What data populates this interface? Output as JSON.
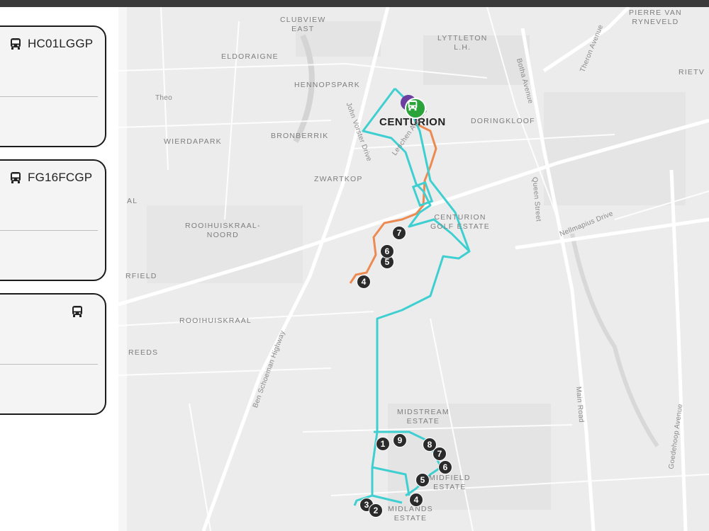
{
  "vehicles": [
    {
      "plate": "HC01LGGP",
      "icon": "bus-icon"
    },
    {
      "plate": "FG16FCGP",
      "icon": "bus-icon"
    },
    {
      "plate": "",
      "icon": "bus-icon"
    }
  ],
  "map": {
    "labels": {
      "clubview": "CLUBVIEW\nEAST",
      "lyttleton": "LYTTLETON\nL.H.",
      "pierre": "PIERRE VAN\nRYNEVELD",
      "eldoraigne": "ELDORAIGNE",
      "hennopspark": "HENNOPSPARK",
      "rietv": "RIETV",
      "theo": "Theo",
      "doringkloof": "DORINGKLOOF",
      "bronberrik": "BRONBERRIK",
      "wierdapark": "WIERDAPARK",
      "zwartkop": "ZWARTKOP",
      "centurion_golf": "CENTURION\nGOLF ESTATE",
      "rooihuiskraal_noord": "ROOIHUISKRAAL-\nNOORD",
      "al": "AL",
      "rfield": "RFIELD",
      "rooihuiskraal": "ROOIHUISKRAAL",
      "reeds": "REEDS",
      "midstream": "MIDSTREAM\nESTATE",
      "midfield": "MIDFIELD\nESTATE",
      "midlands": "MIDLANDS\nESTATE",
      "centurion": "CENTURION"
    },
    "roads": {
      "botha": "Botha Avenue",
      "theron": "Theron Avenue",
      "queen": "Queen Street",
      "nellmapius": "Nellmapius Drive",
      "john_vorster": "John Vorster Drive",
      "lenchen": "Lenchen Avenue",
      "ben_schoeman": "Ben Schoeman Highway",
      "main_road": "Main Road",
      "goedehoop": "Goedehoop Avenue"
    },
    "route_colors": {
      "cyan": "#3fcfd0",
      "orange": "#ec8a52",
      "marker": "#2aa43a"
    },
    "orange_stops": [
      "7",
      "6",
      "5",
      "4"
    ],
    "cyan_stops": [
      "1",
      "9",
      "8",
      "7",
      "6",
      "5",
      "4",
      "3",
      "2"
    ]
  }
}
